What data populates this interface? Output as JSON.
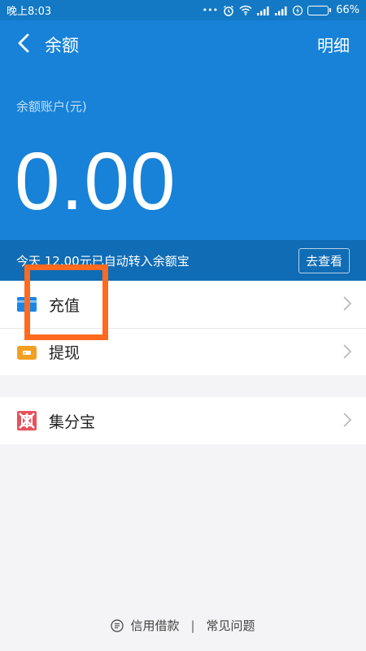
{
  "status_bar": {
    "time": "晚上8:03",
    "battery_text": "66%",
    "battery_level": 0.66,
    "icons": [
      "more-dots-icon",
      "alarm-icon",
      "wifi-icon",
      "signal-icon",
      "signal-icon",
      "charging-icon",
      "battery-icon"
    ]
  },
  "nav": {
    "title": "余额",
    "detail_label": "明细"
  },
  "account": {
    "label": "余额账户(元)",
    "balance": "0.00"
  },
  "notice": {
    "text": "今天 12.00元已自动转入余额宝",
    "button_label": "去查看"
  },
  "menu_primary": [
    {
      "label": "充值",
      "icon": "card-icon"
    },
    {
      "label": "提现",
      "icon": "wallet-icon"
    }
  ],
  "menu_secondary": [
    {
      "label": "集分宝",
      "icon": "jifenbao-icon"
    }
  ],
  "footer": {
    "credit_label": "信用借款",
    "faq_label": "常见问题"
  },
  "colors": {
    "header_bg": "#1782d8",
    "notice_bg": "#106cb5",
    "highlight": "#ff6a1f",
    "card_icon": "#1a87e6",
    "wallet_icon": "#f2a021",
    "jifenbao_icon": "#e8505b"
  }
}
